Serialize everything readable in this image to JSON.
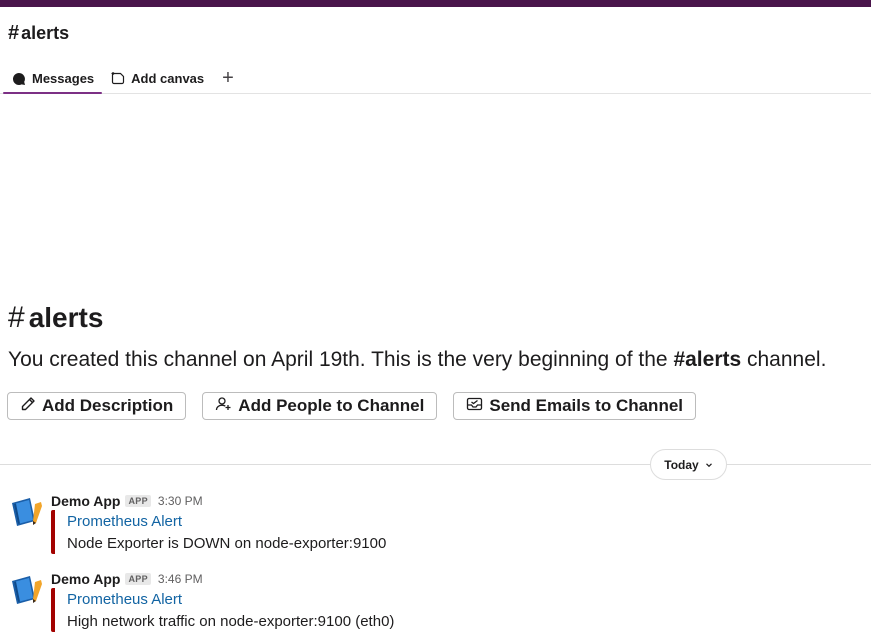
{
  "header": {
    "channel_name": "alerts",
    "hash_symbol": "#"
  },
  "tabs": [
    {
      "label": "Messages",
      "icon": "message-bubble-icon",
      "active": true
    },
    {
      "label": "Add canvas",
      "icon": "canvas-icon",
      "active": false
    },
    {
      "label": "+",
      "icon": "plus-icon",
      "active": false
    }
  ],
  "intro": {
    "title": "alerts",
    "text_before": "You created this channel on April 19th. This is the very beginning of the ",
    "channel_ref": "alerts",
    "text_after": " channel."
  },
  "actions": [
    {
      "label": "Add Description",
      "icon": "pencil-icon"
    },
    {
      "label": "Add People to Channel",
      "icon": "add-person-icon"
    },
    {
      "label": "Send Emails to Channel",
      "icon": "email-inbox-icon"
    }
  ],
  "date_divider": {
    "label": "Today"
  },
  "messages": [
    {
      "sender": "Demo App",
      "badge": "APP",
      "time": "3:30 PM",
      "attachment_title": "Prometheus Alert",
      "attachment_text": "Node Exporter is DOWN on node-exporter:9100",
      "bar_color": "#a30200"
    },
    {
      "sender": "Demo App",
      "badge": "APP",
      "time": "3:46 PM",
      "attachment_title": "Prometheus Alert",
      "attachment_text": "High network traffic on node-exporter:9100 (eth0)",
      "bar_color": "#a30200"
    }
  ],
  "colors": {
    "brand_strip": "#4a154b",
    "tab_underline": "#7c3085",
    "link": "#1264a3",
    "alert_bar": "#a30200"
  }
}
